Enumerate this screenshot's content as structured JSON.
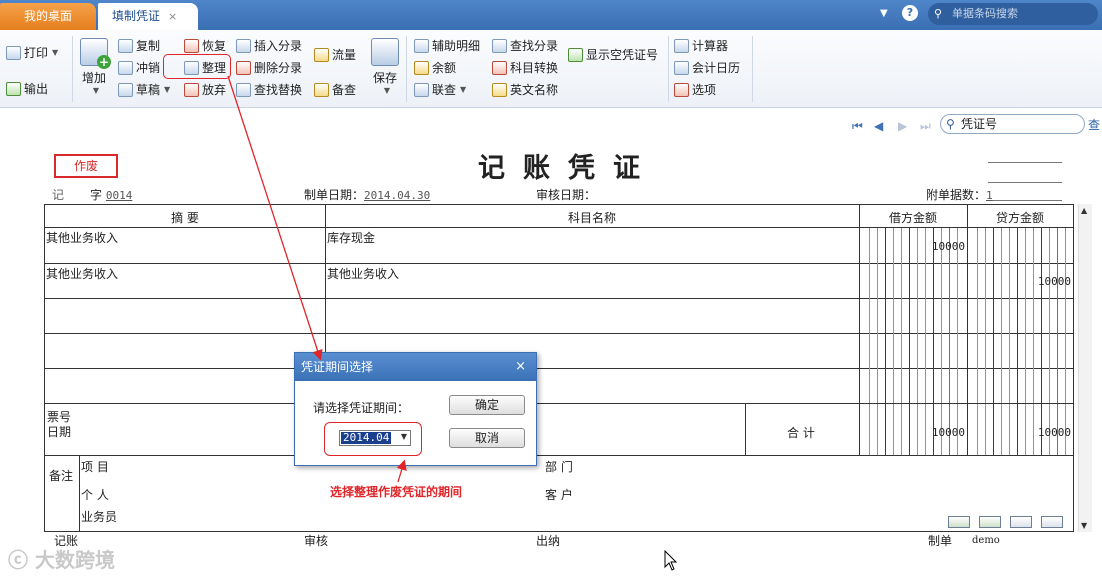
{
  "tabs": {
    "home": "我的桌面",
    "active": "填制凭证",
    "close": "×"
  },
  "topbar": {
    "search_placeholder": "单据条码搜索",
    "help": "?",
    "dropdown": "▼"
  },
  "ribbon": {
    "print": "打印",
    "export": "输出",
    "add": "增加",
    "copy": "复制",
    "reverse": "冲销",
    "draft": "草稿",
    "restore": "恢复",
    "organize": "整理",
    "abandon": "放弃",
    "insert_entry": "插入分录",
    "delete_entry": "删除分录",
    "find_replace": "查找替换",
    "cashflow": "流量",
    "backup": "备查",
    "save": "保存",
    "aux_detail": "辅助明细",
    "balance": "余额",
    "link_query": "联查",
    "find_entry": "查找分录",
    "account_convert": "科目转换",
    "english_name": "英文名称",
    "show_empty": "显示空凭证号",
    "calculator": "计算器",
    "calendar": "会计日历",
    "options": "选项"
  },
  "nav": {
    "search_value": "凭证号",
    "query": "查"
  },
  "voucher": {
    "void_stamp": "作废",
    "title": "记账凭证",
    "type_char": "记",
    "zi": "字",
    "number": "0014",
    "date_label": "制单日期：",
    "date": "2014.04.30",
    "audit_label": "审核日期：",
    "attach_label": "附单据数：",
    "attach_count": "1",
    "headers": {
      "summary": "摘 要",
      "account": "科目名称",
      "debit": "借方金额",
      "credit": "贷方金额"
    },
    "rows": [
      {
        "summary": "其他业务收入",
        "account": "库存现金",
        "debit": "10000",
        "credit": ""
      },
      {
        "summary": "其他业务收入",
        "account": "其他业务收入",
        "debit": "",
        "credit": "10000"
      },
      {
        "summary": "",
        "account": "",
        "debit": "",
        "credit": ""
      },
      {
        "summary": "",
        "account": "",
        "debit": "",
        "credit": ""
      },
      {
        "summary": "",
        "account": "",
        "debit": "",
        "credit": ""
      }
    ],
    "ticket_no": "票号",
    "ticket_date": "日期",
    "total_label": "合 计",
    "total_debit": "10000",
    "total_credit": "10000",
    "remark": "备注",
    "project": "项  目",
    "person": "个  人",
    "salesperson": "业务员",
    "department": "部  门",
    "customer": "客  户",
    "signatures": {
      "bookkeeper": "记账",
      "auditor": "审核",
      "cashier": "出纳",
      "maker": "制单",
      "maker_name": "demo"
    }
  },
  "dialog": {
    "title": "凭证期间选择",
    "close": "×",
    "prompt": "请选择凭证期间：",
    "ok": "确定",
    "cancel": "取消",
    "period": "2014.04"
  },
  "annotation": "选择整理作废凭证的期间",
  "watermark": "大数跨境",
  "colors": {
    "accent_red": "#e0262a",
    "tab_blue": "#3a6fb3",
    "home_orange": "#f08c2e"
  }
}
